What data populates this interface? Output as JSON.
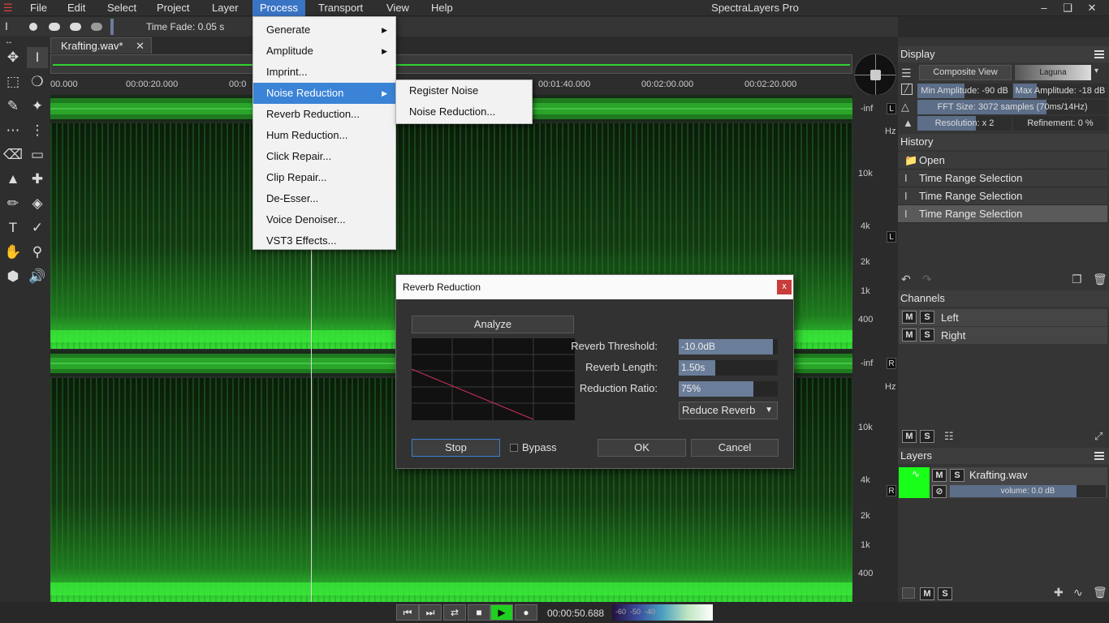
{
  "app": {
    "title": "SpectraLayers Pro",
    "menu": [
      "File",
      "Edit",
      "Select",
      "Project",
      "Layer",
      "Process",
      "Transport",
      "View",
      "Help"
    ],
    "active_menu": "Process"
  },
  "options": {
    "time_fade": "Time Fade: 0.05 s"
  },
  "tab": {
    "name": "Krafting.wav*"
  },
  "ruler": {
    "ticks": [
      "00.000",
      "00:00:20.000",
      "00:0",
      "00:01:40.000",
      "00:02:00.000",
      "00:02:20.000"
    ]
  },
  "channels_view": {
    "inf_label": "-inf",
    "hz_label": "Hz",
    "left_letter": "L",
    "right_letter": "R",
    "freq_ticks": [
      "10k",
      "4k",
      "2k",
      "1k",
      "400"
    ]
  },
  "process_menu": {
    "items": [
      "Generate",
      "Amplitude",
      "Imprint...",
      "Noise Reduction",
      "Reverb Reduction...",
      "Hum Reduction...",
      "Click Repair...",
      "Clip Repair...",
      "De-Esser...",
      "Voice Denoiser...",
      "VST3 Effects..."
    ]
  },
  "noise_submenu": {
    "items": [
      "Register Noise",
      "Noise Reduction..."
    ]
  },
  "display": {
    "title": "Display",
    "view_button": "Composite View",
    "palette": "Laguna",
    "min_amp": "Min Amplitude: -90 dB",
    "max_amp": "Max Amplitude: -18 dB",
    "fft": "FFT Size: 3072 samples (70ms/14Hz)",
    "resolution": "Resolution: x 2",
    "refinement": "Refinement: 0 %"
  },
  "history": {
    "title": "History",
    "items": [
      "Open",
      "Time Range Selection",
      "Time Range Selection",
      "Time Range Selection"
    ]
  },
  "channels": {
    "title": "Channels",
    "items": [
      "Left",
      "Right"
    ],
    "m": "M",
    "s": "S"
  },
  "layers": {
    "title": "Layers",
    "name": "Krafting.wav",
    "volume": "volume: 0.0 dB"
  },
  "dialog": {
    "title": "Reverb Reduction",
    "close": "x",
    "analyze": "Analyze",
    "threshold_label": "Reverb Threshold:",
    "threshold_value": "-10.0dB",
    "length_label": "Reverb Length:",
    "length_value": "1.50s",
    "ratio_label": "Reduction Ratio:",
    "ratio_value": "75%",
    "mode": "Reduce Reverb",
    "stop": "Stop",
    "bypass": "Bypass",
    "ok": "OK",
    "cancel": "Cancel"
  },
  "transport": {
    "time": "00:00:50.688",
    "scale": [
      "-60",
      "-50",
      "-40"
    ]
  }
}
